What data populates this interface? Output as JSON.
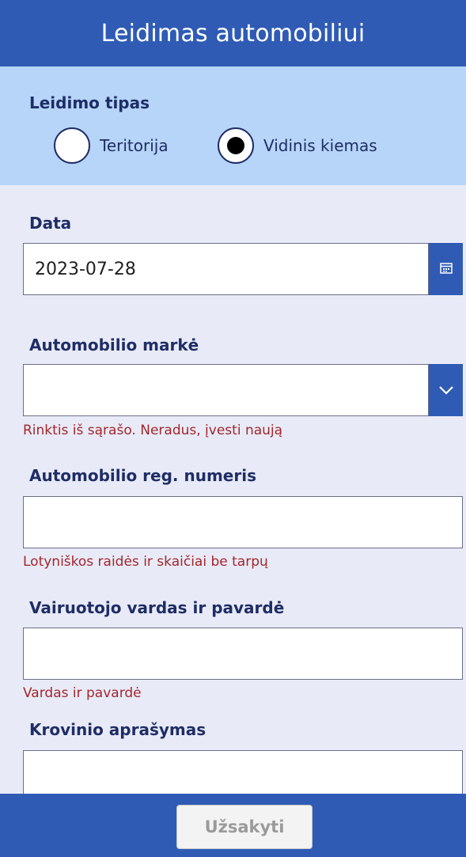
{
  "header": {
    "title": "Leidimas automobiliui"
  },
  "permit_type": {
    "label": "Leidimo tipas",
    "options": [
      {
        "label": "Teritorija",
        "selected": false
      },
      {
        "label": "Vidinis kiemas",
        "selected": true
      }
    ]
  },
  "date": {
    "label": "Data",
    "value": "2023-07-28",
    "icon": "calendar-icon"
  },
  "car_make": {
    "label": "Automobilio markė",
    "value": "",
    "hint": "Rinktis iš sąrašo. Neradus, įvesti naują",
    "icon": "chevron-down-icon"
  },
  "reg_number": {
    "label": "Automobilio reg. numeris",
    "value": "",
    "hint": "Lotyniškos raidės ir skaičiai be tarpų"
  },
  "driver": {
    "label": "Vairuotojo vardas ir pavardė",
    "value": "",
    "hint": "Vardas ir pavardė"
  },
  "cargo": {
    "label": "Krovinio aprašymas",
    "value": ""
  },
  "footer": {
    "submit_label": "Užsakyti"
  },
  "colors": {
    "brand": "#2f5bb5",
    "panel": "#b6d5f8",
    "background": "#e8ebf7",
    "hint": "#a4262c",
    "label": "#1f2d66"
  }
}
